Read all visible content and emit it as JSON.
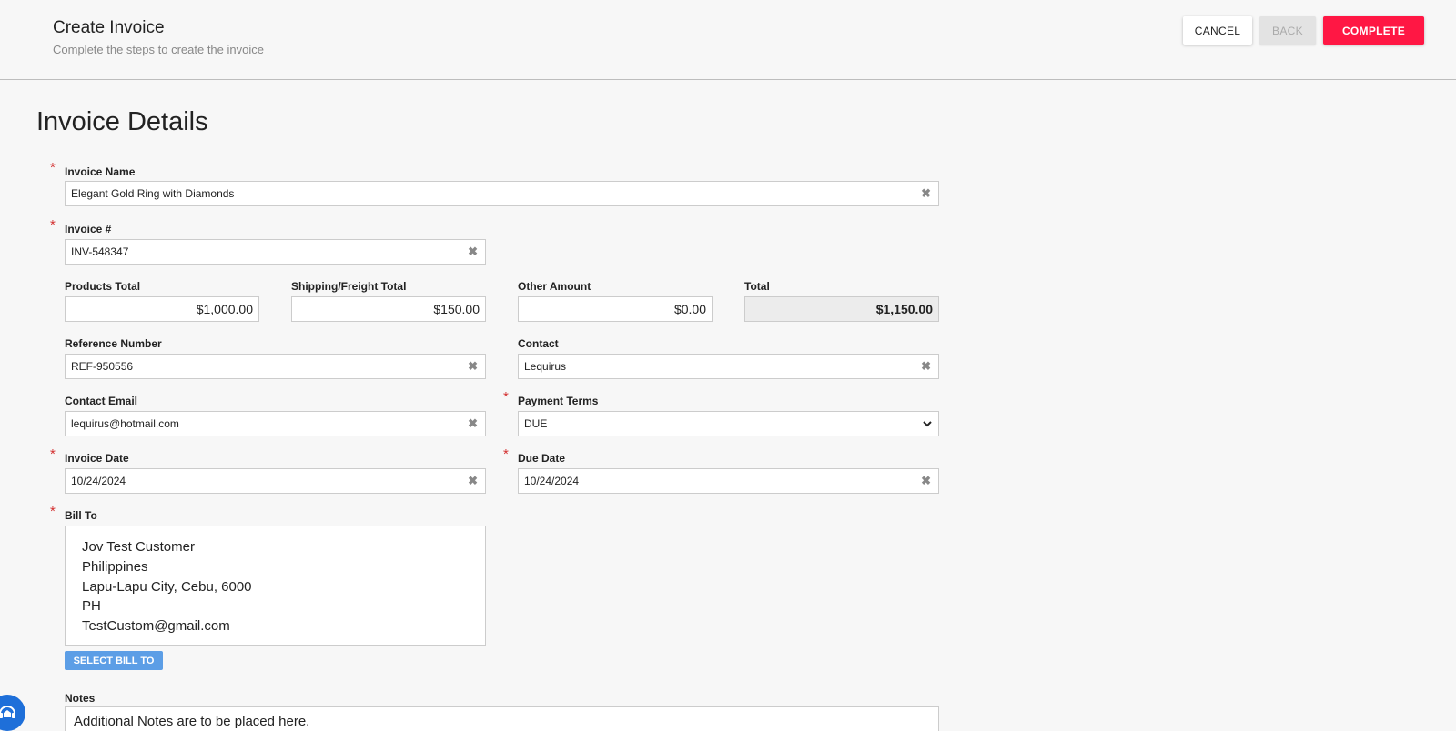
{
  "header": {
    "title": "Create Invoice",
    "subtitle": "Complete the steps to create the invoice",
    "cancel_label": "CANCEL",
    "back_label": "BACK",
    "complete_label": "COMPLETE"
  },
  "section_title": "Invoice Details",
  "fields": {
    "invoice_name": {
      "label": "Invoice Name",
      "value": "Elegant Gold Ring with Diamonds"
    },
    "invoice_number": {
      "label": "Invoice #",
      "value": "INV-548347"
    },
    "products_total": {
      "label": "Products Total",
      "value": "$1,000.00"
    },
    "shipping_total": {
      "label": "Shipping/Freight Total",
      "value": "$150.00"
    },
    "other_amount": {
      "label": "Other Amount",
      "value": "$0.00"
    },
    "total": {
      "label": "Total",
      "value": "$1,150.00"
    },
    "reference_number": {
      "label": "Reference Number",
      "value": "REF-950556"
    },
    "contact": {
      "label": "Contact",
      "value": "Lequirus"
    },
    "contact_email": {
      "label": "Contact Email",
      "value": "lequirus@hotmail.com"
    },
    "payment_terms": {
      "label": "Payment Terms",
      "value": "DUE"
    },
    "invoice_date": {
      "label": "Invoice Date",
      "value": "10/24/2024"
    },
    "due_date": {
      "label": "Due Date",
      "value": "10/24/2024"
    },
    "bill_to": {
      "label": "Bill To",
      "lines": [
        "Jov Test Customer",
        "Philippines",
        "Lapu-Lapu City, Cebu, 6000",
        "PH",
        "TestCustom@gmail.com"
      ],
      "button_label": "SELECT BILL TO"
    },
    "notes": {
      "label": "Notes",
      "value": "Additional Notes are to be placed here."
    }
  },
  "required_mark": "*",
  "clear_glyph": "✖",
  "select_glyph": "⌄",
  "icons": {
    "clear": "clear-icon",
    "dropdown": "chevron-down-icon",
    "chat": "chat-support-icon"
  },
  "colors": {
    "accent": "#ff1744",
    "required": "#d32f2f",
    "bill_to_button": "#5c9ee6",
    "chat_button": "#1e6fd9"
  }
}
